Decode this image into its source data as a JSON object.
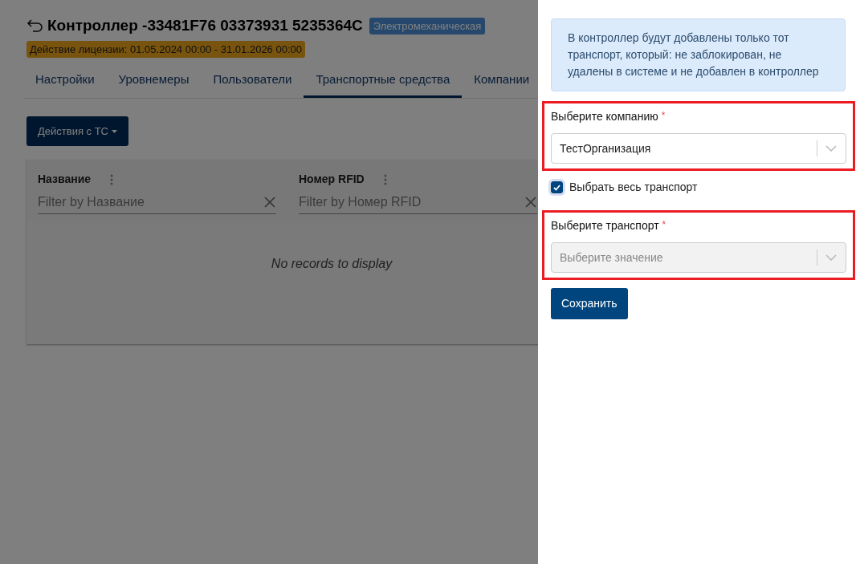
{
  "page": {
    "title": "Контроллер -33481F76 03373931 5235364C",
    "type_badge": "Электромеханическая",
    "license": "Действие лицензии: 01.05.2024 00:00 - 31.01.2026 00:00",
    "tabs": [
      {
        "label": "Настройки",
        "selected": false
      },
      {
        "label": "Уровнемеры",
        "selected": false
      },
      {
        "label": "Пользователи",
        "selected": false
      },
      {
        "label": "Транспортные средства",
        "selected": true
      },
      {
        "label": "Компании",
        "selected": false
      }
    ],
    "actions_button": "Действия с ТС",
    "table": {
      "columns": [
        {
          "label": "Название",
          "filter_placeholder": "Filter by Название"
        },
        {
          "label": "Номер RFID",
          "filter_placeholder": "Filter by Номер RFID"
        }
      ],
      "empty_message": "No records to display"
    }
  },
  "panel": {
    "notice": "В контроллер будут добавлены только тот транспорт, который: не заблокирован, не удалены в системе и не добавлен в контроллер",
    "company": {
      "label": "Выберите компанию",
      "required_mark": "*",
      "value": "ТестОрганизация",
      "highlighted": true
    },
    "select_all": {
      "label": "Выбрать весь транспорт",
      "checked": true
    },
    "transport": {
      "label": "Выберите транспорт",
      "required_mark": "*",
      "placeholder": "Выберите значение",
      "disabled": true,
      "highlighted": true
    },
    "save_button": "Сохранить"
  }
}
